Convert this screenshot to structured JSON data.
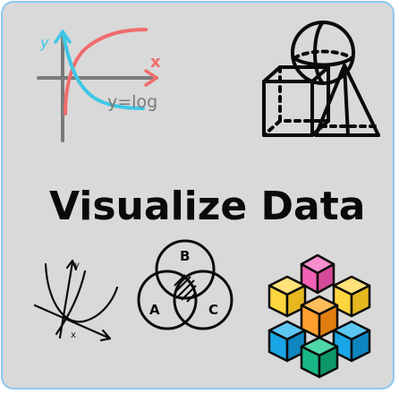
{
  "headline": "Visualize Data",
  "icons": {
    "log_graph": {
      "name": "log-graph-icon",
      "function_label": "y=log",
      "x_axis_label": "x",
      "y_axis_label": "y"
    },
    "solids": {
      "name": "geometric-solids-icon"
    },
    "parabola": {
      "name": "parabola-graph-icon",
      "x_axis_label": "x",
      "y_axis_label": "y"
    },
    "venn": {
      "name": "venn-diagram-icon",
      "set_a": "A",
      "set_b": "B",
      "set_c": "C"
    },
    "cubes": {
      "name": "cube-stack-icon"
    }
  },
  "colors": {
    "card_background": "#d9d9d9",
    "card_border": "#8cc8ef",
    "curve_red": "#f06c6c",
    "curve_cyan": "#3fc7e6",
    "cube_pink": "#f261b5",
    "cube_yellow": "#fcd53f",
    "cube_orange": "#ff9f2d",
    "cube_blue": "#1aa6e6",
    "cube_green": "#18b886"
  }
}
